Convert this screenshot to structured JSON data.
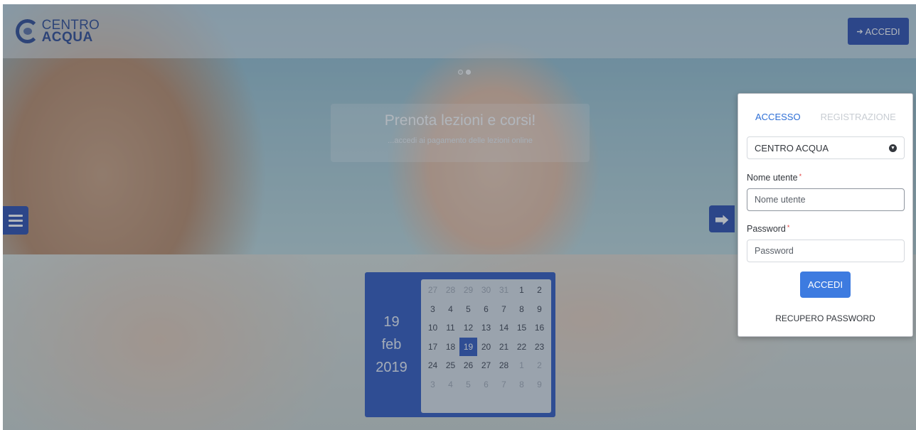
{
  "header": {
    "logo_top": "CENTRO",
    "logo_bottom": "ACQUA",
    "login_label": "ACCEDI",
    "login_icon": "sign-in-icon"
  },
  "slider": {
    "title": "Prenota lezioni e corsi!",
    "subtitle": "...accedi ai pagamento delle lezioni online",
    "dots": 2,
    "active_dot": 1
  },
  "calendar": {
    "day": "19",
    "month": "feb",
    "year": "2019",
    "rows": [
      [
        "27",
        "28",
        "29",
        "30",
        "31",
        "1",
        "2"
      ],
      [
        "3",
        "4",
        "5",
        "6",
        "7",
        "8",
        "9"
      ],
      [
        "10",
        "11",
        "12",
        "13",
        "14",
        "15",
        "16"
      ],
      [
        "17",
        "18",
        "19",
        "20",
        "21",
        "22",
        "23"
      ],
      [
        "24",
        "25",
        "26",
        "27",
        "28",
        "1",
        "2"
      ],
      [
        "3",
        "4",
        "5",
        "6",
        "7",
        "8",
        "9"
      ]
    ],
    "selected": "19"
  },
  "login_panel": {
    "tab_login": "ACCESSO",
    "tab_register": "REGISTRAZIONE",
    "center_select": "CENTRO ACQUA",
    "username_label": "Nome utente",
    "username_placeholder": "Nome utente",
    "password_label": "Password",
    "password_placeholder": "Password",
    "required_mark": "*",
    "submit_label": "ACCEDI",
    "recover_label": "RECUPERO PASSWORD"
  },
  "colors": {
    "primary": "#1a3ea8",
    "button": "#3d7be0",
    "tab_active": "#2e6fd6"
  }
}
